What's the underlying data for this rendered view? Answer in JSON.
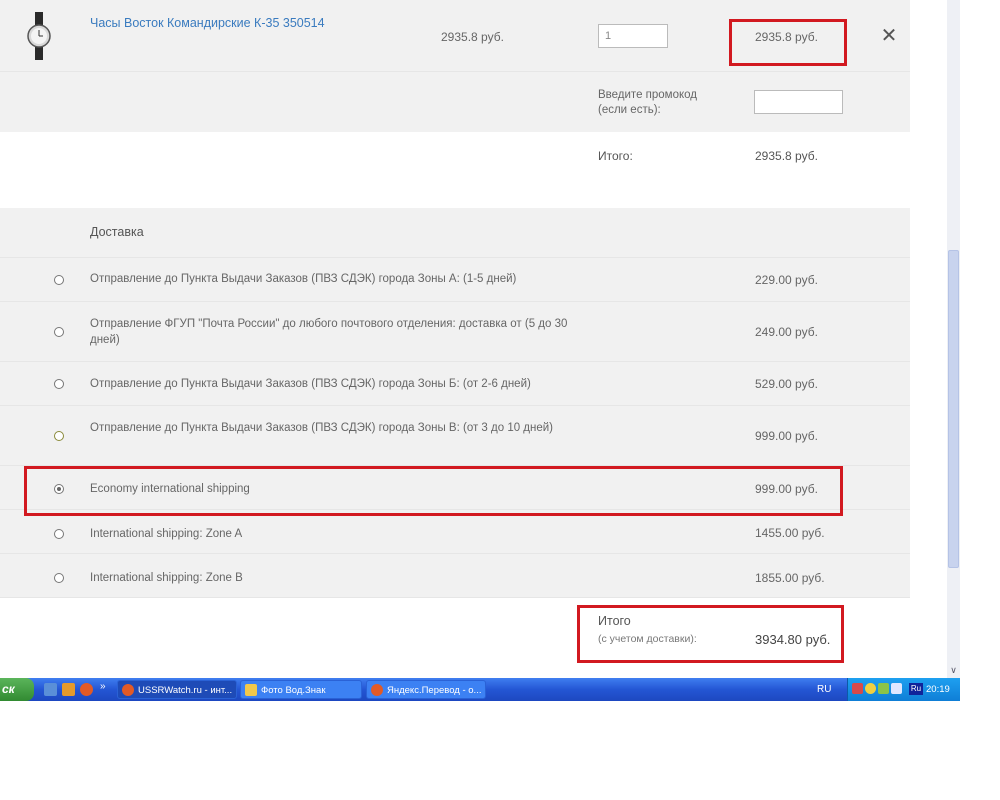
{
  "cart": {
    "product_name": "Часы Восток Командирские К-35 350514",
    "unit_price": "2935.8 руб.",
    "quantity": "1",
    "line_total": "2935.8 руб.",
    "close_symbol": "✕",
    "promo_label": "Введите промокод (если есть):",
    "promo_value": "",
    "subtotal_label": "Итого:",
    "subtotal_value": "2935.8 руб."
  },
  "delivery": {
    "title": "Доставка",
    "options": [
      {
        "name": "Отправление до Пункта Выдачи Заказов (ПВЗ СДЭК) города Зоны А: (1-5 дней)",
        "price": "229.00 руб.",
        "selected": false
      },
      {
        "name": "Отправление ФГУП \"Почта России\" до любого почтового отделения: доставка от (5 до 30 дней)",
        "price": "249.00 руб.",
        "selected": false
      },
      {
        "name": "Отправление до Пункта Выдачи Заказов (ПВЗ СДЭК) города Зоны Б: (от 2-6 дней)",
        "price": "529.00 руб.",
        "selected": false
      },
      {
        "name": "Отправление до Пункта Выдачи Заказов (ПВЗ СДЭК) города Зоны В: (от 3 до 10 дней)",
        "price": "999.00 руб.",
        "selected": false
      },
      {
        "name": "Economy international shipping",
        "price": "999.00 руб.",
        "selected": true
      },
      {
        "name": "International shipping: Zone A",
        "price": "1455.00 руб.",
        "selected": false
      },
      {
        "name": "International shipping: Zone B",
        "price": "1855.00 руб.",
        "selected": false
      }
    ]
  },
  "grand_total": {
    "label": "Итого",
    "sublabel": "(с учетом доставки):",
    "value": "3934.80 руб."
  },
  "scrollbar": {
    "down_arrow": "∨"
  },
  "taskbar": {
    "start_label": "ск",
    "quicklaunch_more": "»",
    "tasks": [
      {
        "label": "USSRWatch.ru - инт...",
        "active": true
      },
      {
        "label": "Фото Вод.Знак",
        "active": false
      },
      {
        "label": "Яндекс.Перевод - о...",
        "active": false
      }
    ],
    "language": "RU",
    "tray_lang": "Ru",
    "clock": "20:19"
  },
  "colors": {
    "highlight_red": "#d21920",
    "link_blue": "#3a7bbf",
    "row_gray": "#f1f1f1",
    "taskbar_blue": "#2456d4"
  }
}
